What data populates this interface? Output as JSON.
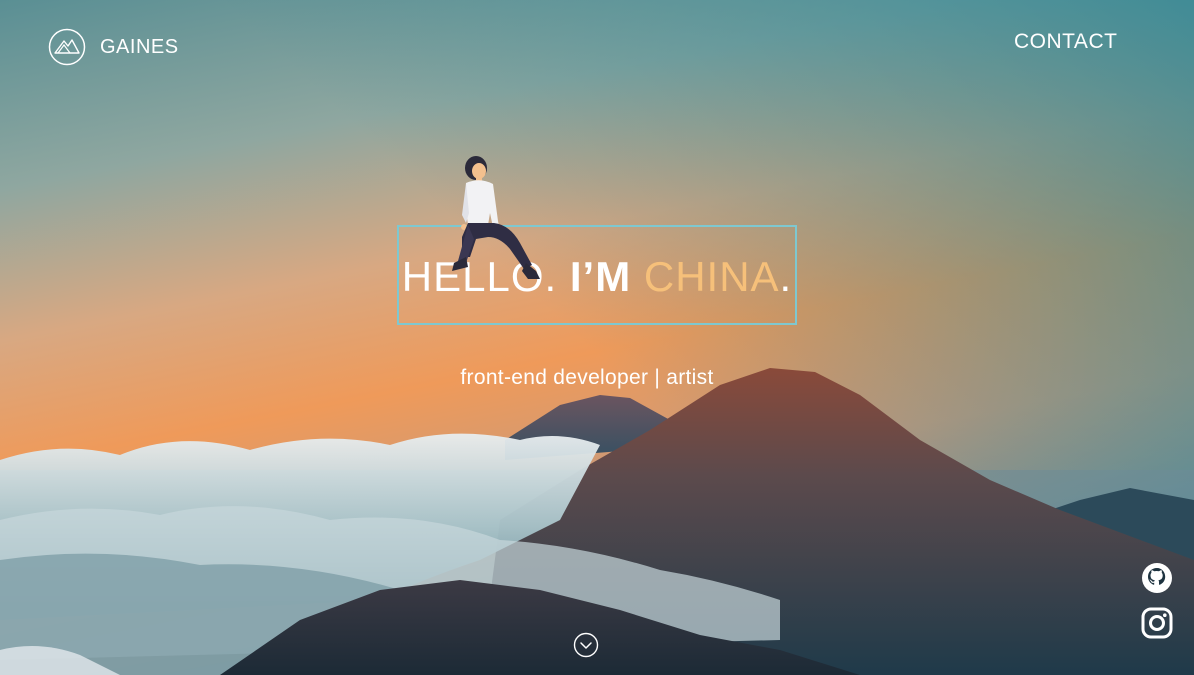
{
  "nav": {
    "brand": "GAINES",
    "contact": "CONTACT"
  },
  "hero": {
    "greeting": "HELLO.",
    "im": "I’M",
    "name": "CHINA",
    "period": ".",
    "subtitle": "front-end developer | artist"
  },
  "social": [
    {
      "icon": "github-icon"
    },
    {
      "icon": "instagram-icon"
    }
  ],
  "scroll": {
    "icon": "chevron-down-icon"
  },
  "colors": {
    "accent_name": "#f6c07a",
    "box_border": "#7ec8d0",
    "text": "#ffffff"
  }
}
